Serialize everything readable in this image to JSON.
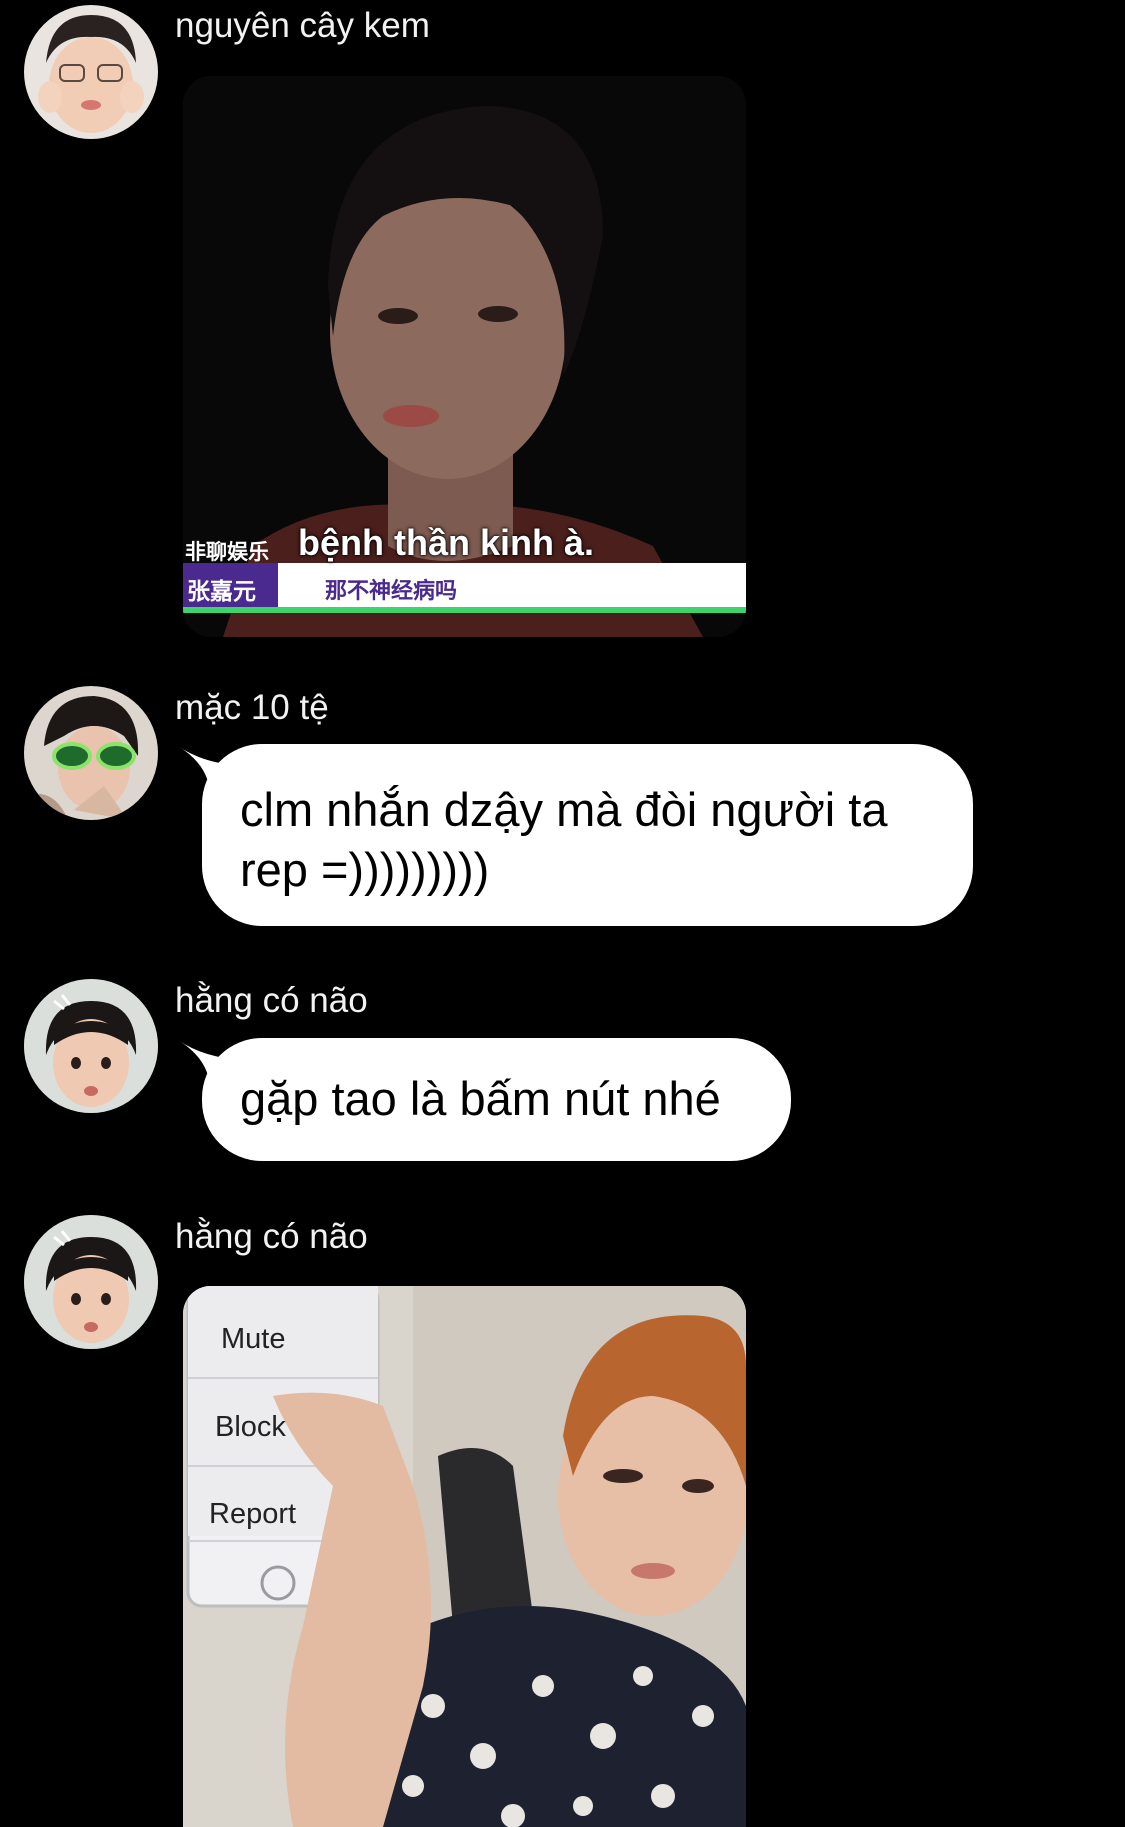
{
  "messages": [
    {
      "sender": "nguyên cây kem",
      "type": "image",
      "image": {
        "subtitle": "bệnh thần kinh à.",
        "subtitle_cn": "那不神经病吗",
        "channel_tag": "非聊娱乐",
        "name_tag": "张嘉元"
      }
    },
    {
      "sender": "mặc 10 tệ",
      "type": "text",
      "line1": "clm nhắn dzậy mà đòi người ta",
      "line2": "rep =)))))))))"
    },
    {
      "sender": "hằng có não",
      "type": "text",
      "line1": "gặp tao là bấm nút nhé"
    },
    {
      "sender": "hằng có não",
      "type": "image",
      "image": {
        "menu": [
          "Mute",
          "Block",
          "Report"
        ]
      }
    }
  ],
  "colors": {
    "background": "#000000",
    "bubble": "#ffffff",
    "bubble_text": "#000000",
    "sender_text": "#f2f2f2"
  }
}
